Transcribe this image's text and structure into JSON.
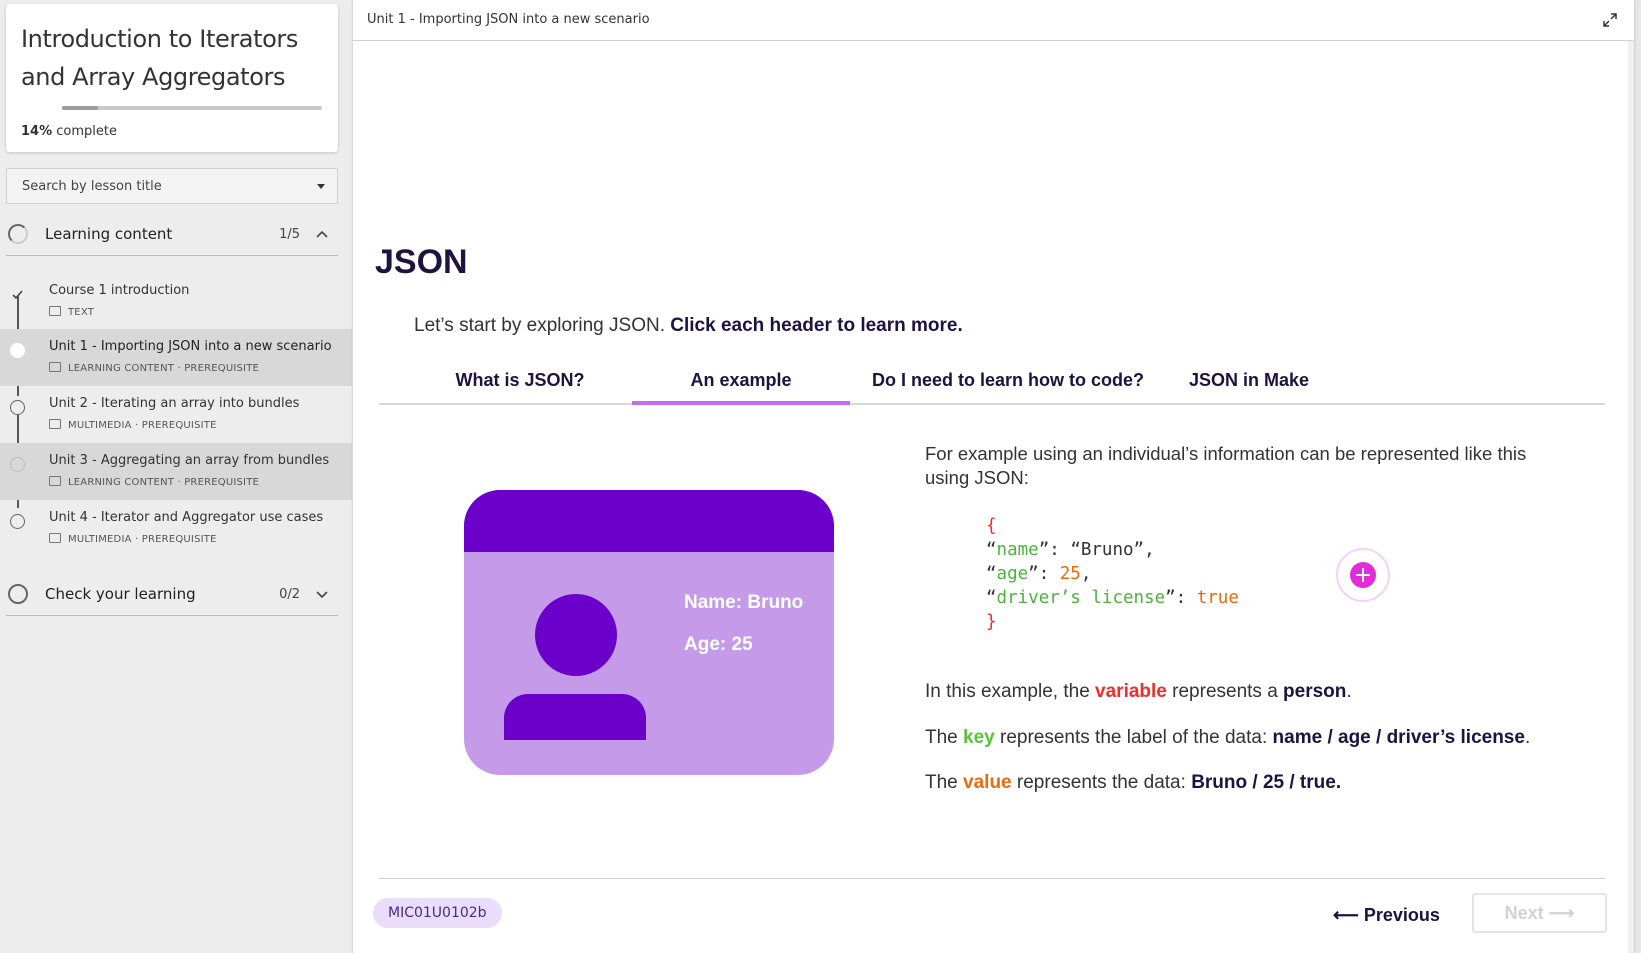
{
  "sidebar": {
    "course_title": "Introduction to Iterators and Array Aggregators",
    "progress_percent": 14,
    "progress_value": "14%",
    "progress_suffix": "complete",
    "search_placeholder": "Search by lesson title",
    "sections": [
      {
        "label": "Learning content",
        "count": "1/5",
        "expanded": true,
        "lessons": [
          {
            "title": "Course 1 introduction",
            "meta": "TEXT",
            "state": "completed"
          },
          {
            "title": "Unit 1 - Importing JSON into a new scenario",
            "meta": "LEARNING CONTENT · PREREQUISITE",
            "state": "active"
          },
          {
            "title": "Unit 2 - Iterating an array into bundles",
            "meta": "MULTIMEDIA · PREREQUISITE",
            "state": "not-started"
          },
          {
            "title": "Unit 3 - Aggregating an array from bundles",
            "meta": "LEARNING CONTENT · PREREQUISITE",
            "state": "not-started"
          },
          {
            "title": "Unit 4 - Iterator and Aggregator use cases",
            "meta": "MULTIMEDIA · PREREQUISITE",
            "state": "not-started"
          }
        ]
      },
      {
        "label": "Check your learning",
        "count": "0/2",
        "expanded": false
      }
    ]
  },
  "topbar": {
    "title": "Unit 1 - Importing JSON into a new scenario"
  },
  "content": {
    "heading": "JSON",
    "intro_plain": "Let’s start by exploring JSON. ",
    "intro_bold": "Click each header to learn more.",
    "tabs": [
      "What is JSON?",
      "An example",
      "Do I need to learn how to code?",
      "JSON in Make"
    ],
    "selected_tab": "An example",
    "card": {
      "name": "Name: Bruno",
      "age": "Age: 25"
    },
    "description": "For example using an individual’s information can be represented like this using JSON:",
    "code": {
      "open": "{",
      "lines": [
        {
          "key": "name",
          "value": "“Bruno”",
          "sep": ","
        },
        {
          "key": "age",
          "value": "25",
          "sep": ","
        },
        {
          "key": "driver’s license",
          "value": "true",
          "sep": ""
        }
      ],
      "close": "}"
    },
    "para1": {
      "a": "In this example, the ",
      "hl": "variable",
      "b": " represents a ",
      "bold": "person",
      "c": "."
    },
    "para2": {
      "a": "The ",
      "hl": "key",
      "b": " represents the label of the data: ",
      "bold": "name / age / driver’s license",
      "c": "."
    },
    "para3": {
      "a": "The ",
      "hl": "value",
      "b": " represents the data: ",
      "bold": "Bruno / 25 / true."
    }
  },
  "footer": {
    "lesson_code": "MIC01U0102b",
    "previous_label": "Previous",
    "next_label": "Next"
  },
  "colors": {
    "accent": "#c56cf0",
    "card_header": "#6a00c9",
    "card_body": "#c49ae9",
    "heading": "#1d1240",
    "variable": "#ef2d2d",
    "key": "#5ac13d",
    "value": "#e86b0d"
  }
}
